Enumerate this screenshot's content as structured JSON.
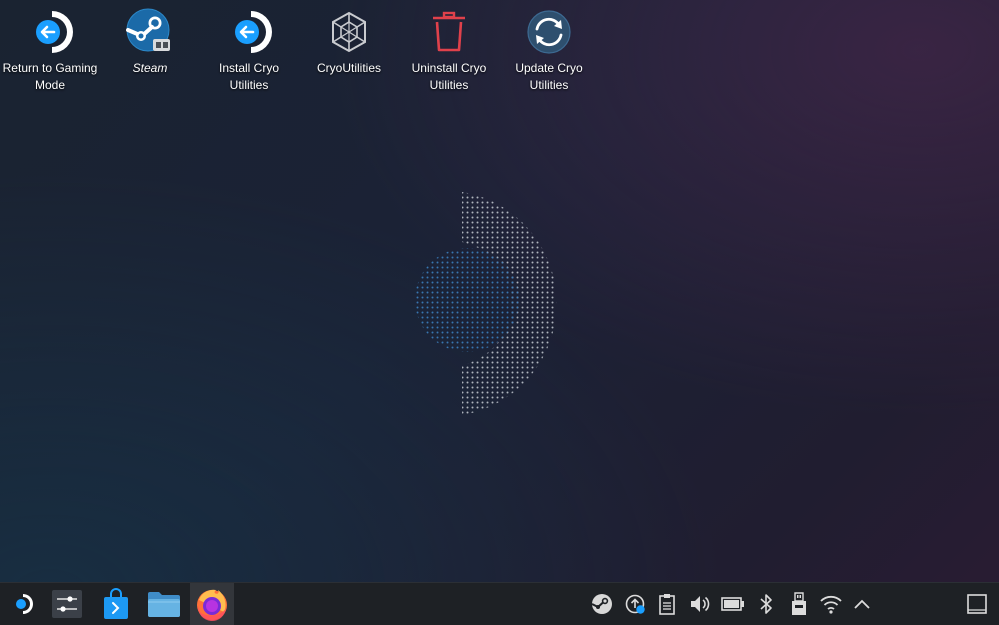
{
  "desktop": {
    "icons": [
      {
        "label": "Return to Gaming Mode",
        "icon": "steamdeck-return-icon"
      },
      {
        "label": "Steam",
        "icon": "steam-icon"
      },
      {
        "label": "Install Cryo Utilities",
        "icon": "steamdeck-install-icon"
      },
      {
        "label": "CryoUtilities",
        "icon": "hexagon-network-icon"
      },
      {
        "label": "Uninstall Cryo Utilities",
        "icon": "trash-icon"
      },
      {
        "label": "Update Cryo Utilities",
        "icon": "refresh-icon"
      }
    ],
    "wallpaper": {
      "logo": "steamdeck-logo-dotted"
    }
  },
  "taskbar": {
    "apps": [
      {
        "name": "application-launcher",
        "icon": "steamdeck-menu-icon"
      },
      {
        "name": "system-settings",
        "icon": "sliders-icon"
      },
      {
        "name": "discover",
        "icon": "store-bag-icon"
      },
      {
        "name": "dolphin",
        "icon": "folder-icon"
      },
      {
        "name": "firefox",
        "icon": "firefox-icon",
        "active": true
      }
    ],
    "tray": [
      {
        "name": "steam",
        "icon": "steam-tray-icon"
      },
      {
        "name": "updates",
        "icon": "update-notifier-icon"
      },
      {
        "name": "clipboard",
        "icon": "clipboard-icon"
      },
      {
        "name": "volume",
        "icon": "speaker-icon"
      },
      {
        "name": "battery",
        "icon": "battery-icon"
      },
      {
        "name": "bluetooth",
        "icon": "bluetooth-icon"
      },
      {
        "name": "storage",
        "icon": "sd-card-icon"
      },
      {
        "name": "network",
        "icon": "wifi-icon"
      },
      {
        "name": "show-hidden",
        "icon": "chevron-up-icon"
      },
      {
        "name": "show-desktop",
        "icon": "show-desktop-icon"
      }
    ]
  },
  "colors": {
    "accent_blue": "#1a9fff",
    "trash_red": "#e0414b",
    "taskbar_bg": "#1e2125"
  }
}
